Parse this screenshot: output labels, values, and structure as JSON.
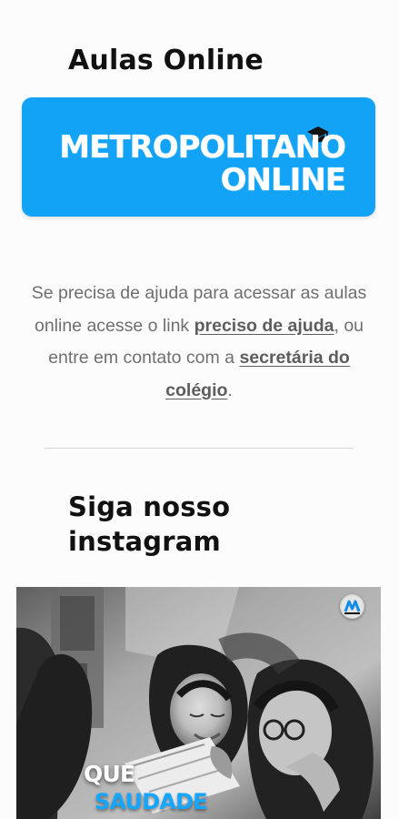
{
  "sections": {
    "online_classes_title": "Aulas Online",
    "instagram_title": "Siga nosso instagram"
  },
  "banner": {
    "line1": "METROPOLITANO",
    "line2": "ONLINE",
    "color": "#12a3f6"
  },
  "help": {
    "prefix": "Se precisa de ajuda para acessar as aulas online acesse o link ",
    "link_help": "preciso de ajuda",
    "middle": ", ou entre em contato com a ",
    "link_secretary": "secretária do colégio",
    "suffix": "."
  },
  "instagram_post": {
    "caption_line1": "QUE",
    "caption_line2": "SAUDADE"
  },
  "icons": {
    "graduation_cap": "graduation-cap-icon",
    "profile_badge": "profile-badge-icon"
  }
}
